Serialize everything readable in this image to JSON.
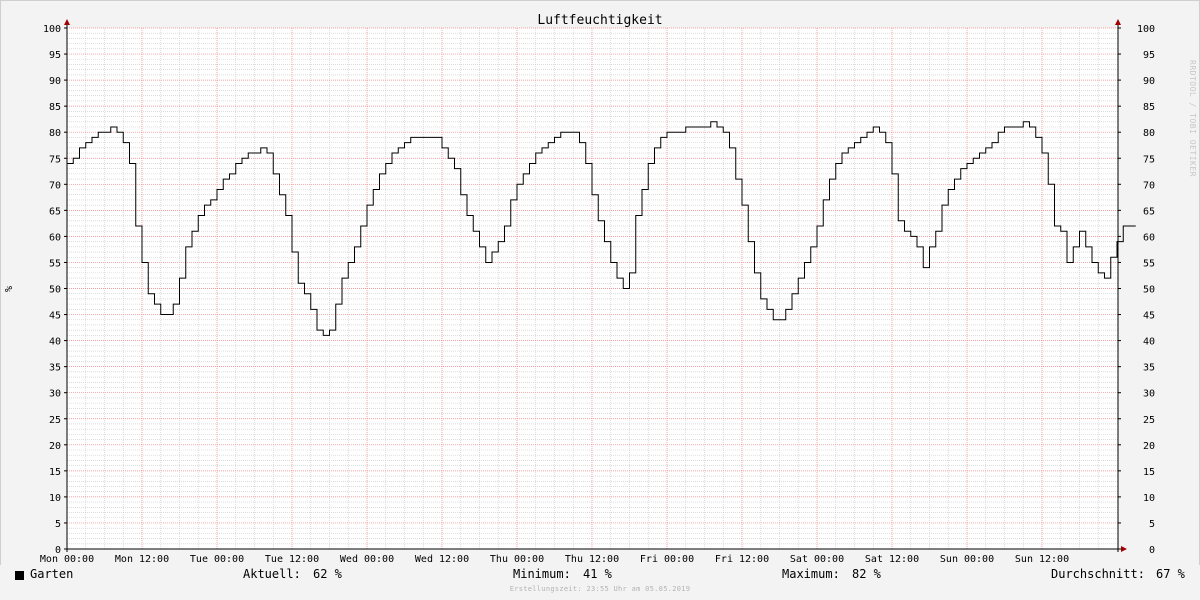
{
  "chart_data": {
    "type": "line",
    "title": "Luftfeuchtigkeit",
    "ylabel": "%",
    "ylim": [
      0,
      100
    ],
    "y_ticks": [
      0,
      5,
      10,
      15,
      20,
      25,
      30,
      35,
      40,
      45,
      50,
      55,
      60,
      65,
      70,
      75,
      80,
      85,
      90,
      95,
      100
    ],
    "x_tick_labels": [
      "Mon 00:00",
      "Mon 12:00",
      "Tue 00:00",
      "Tue 12:00",
      "Wed 00:00",
      "Wed 12:00",
      "Thu 00:00",
      "Thu 12:00",
      "Fri 00:00",
      "Fri 12:00",
      "Sat 00:00",
      "Sat 12:00",
      "Sun 00:00",
      "Sun 12:00"
    ],
    "x_unit": "hours from Mon 00:00",
    "x_range_hours": [
      0,
      168
    ],
    "line_color": "#000000",
    "grid": true,
    "major_grid_color": "#f08080",
    "minor_grid_color": "#c8c8c8",
    "series": [
      {
        "name": "Garten",
        "points": [
          [
            0,
            74
          ],
          [
            1,
            75
          ],
          [
            2,
            77
          ],
          [
            3,
            78
          ],
          [
            4,
            79
          ],
          [
            5,
            80
          ],
          [
            6,
            80
          ],
          [
            7,
            81
          ],
          [
            8,
            80
          ],
          [
            9,
            78
          ],
          [
            10,
            74
          ],
          [
            11,
            62
          ],
          [
            12,
            55
          ],
          [
            13,
            49
          ],
          [
            14,
            47
          ],
          [
            15,
            45
          ],
          [
            16,
            45
          ],
          [
            17,
            47
          ],
          [
            18,
            52
          ],
          [
            19,
            58
          ],
          [
            20,
            61
          ],
          [
            21,
            64
          ],
          [
            22,
            66
          ],
          [
            23,
            67
          ],
          [
            24,
            69
          ],
          [
            25,
            71
          ],
          [
            26,
            72
          ],
          [
            27,
            74
          ],
          [
            28,
            75
          ],
          [
            29,
            76
          ],
          [
            30,
            76
          ],
          [
            31,
            77
          ],
          [
            32,
            76
          ],
          [
            33,
            72
          ],
          [
            34,
            68
          ],
          [
            35,
            64
          ],
          [
            36,
            57
          ],
          [
            37,
            51
          ],
          [
            38,
            49
          ],
          [
            39,
            46
          ],
          [
            40,
            42
          ],
          [
            41,
            41
          ],
          [
            42,
            42
          ],
          [
            43,
            47
          ],
          [
            44,
            52
          ],
          [
            45,
            55
          ],
          [
            46,
            58
          ],
          [
            47,
            62
          ],
          [
            48,
            66
          ],
          [
            49,
            69
          ],
          [
            50,
            72
          ],
          [
            51,
            74
          ],
          [
            52,
            76
          ],
          [
            53,
            77
          ],
          [
            54,
            78
          ],
          [
            55,
            79
          ],
          [
            56,
            79
          ],
          [
            57,
            79
          ],
          [
            58,
            79
          ],
          [
            59,
            79
          ],
          [
            60,
            77
          ],
          [
            61,
            75
          ],
          [
            62,
            73
          ],
          [
            63,
            68
          ],
          [
            64,
            64
          ],
          [
            65,
            61
          ],
          [
            66,
            58
          ],
          [
            67,
            55
          ],
          [
            68,
            57
          ],
          [
            69,
            59
          ],
          [
            70,
            62
          ],
          [
            71,
            67
          ],
          [
            72,
            70
          ],
          [
            73,
            72
          ],
          [
            74,
            74
          ],
          [
            75,
            76
          ],
          [
            76,
            77
          ],
          [
            77,
            78
          ],
          [
            78,
            79
          ],
          [
            79,
            80
          ],
          [
            80,
            80
          ],
          [
            81,
            80
          ],
          [
            82,
            78
          ],
          [
            83,
            74
          ],
          [
            84,
            68
          ],
          [
            85,
            63
          ],
          [
            86,
            59
          ],
          [
            87,
            55
          ],
          [
            88,
            52
          ],
          [
            89,
            50
          ],
          [
            90,
            53
          ],
          [
            91,
            64
          ],
          [
            92,
            69
          ],
          [
            93,
            74
          ],
          [
            94,
            77
          ],
          [
            95,
            79
          ],
          [
            96,
            80
          ],
          [
            97,
            80
          ],
          [
            98,
            80
          ],
          [
            99,
            81
          ],
          [
            100,
            81
          ],
          [
            101,
            81
          ],
          [
            102,
            81
          ],
          [
            103,
            82
          ],
          [
            104,
            81
          ],
          [
            105,
            80
          ],
          [
            106,
            77
          ],
          [
            107,
            71
          ],
          [
            108,
            66
          ],
          [
            109,
            59
          ],
          [
            110,
            53
          ],
          [
            111,
            48
          ],
          [
            112,
            46
          ],
          [
            113,
            44
          ],
          [
            114,
            44
          ],
          [
            115,
            46
          ],
          [
            116,
            49
          ],
          [
            117,
            52
          ],
          [
            118,
            55
          ],
          [
            119,
            58
          ],
          [
            120,
            62
          ],
          [
            121,
            67
          ],
          [
            122,
            71
          ],
          [
            123,
            74
          ],
          [
            124,
            76
          ],
          [
            125,
            77
          ],
          [
            126,
            78
          ],
          [
            127,
            79
          ],
          [
            128,
            80
          ],
          [
            129,
            81
          ],
          [
            130,
            80
          ],
          [
            131,
            78
          ],
          [
            132,
            72
          ],
          [
            133,
            63
          ],
          [
            134,
            61
          ],
          [
            135,
            60
          ],
          [
            136,
            58
          ],
          [
            137,
            54
          ],
          [
            138,
            58
          ],
          [
            139,
            61
          ],
          [
            140,
            66
          ],
          [
            141,
            69
          ],
          [
            142,
            71
          ],
          [
            143,
            73
          ],
          [
            144,
            74
          ],
          [
            145,
            75
          ],
          [
            146,
            76
          ],
          [
            147,
            77
          ],
          [
            148,
            78
          ],
          [
            149,
            80
          ],
          [
            150,
            81
          ],
          [
            151,
            81
          ],
          [
            152,
            81
          ],
          [
            153,
            82
          ],
          [
            154,
            81
          ],
          [
            155,
            79
          ],
          [
            156,
            76
          ],
          [
            157,
            70
          ],
          [
            158,
            62
          ],
          [
            159,
            61
          ],
          [
            160,
            55
          ],
          [
            161,
            58
          ],
          [
            162,
            61
          ],
          [
            163,
            58
          ],
          [
            164,
            55
          ],
          [
            165,
            53
          ],
          [
            166,
            52
          ],
          [
            167,
            56
          ],
          [
            168,
            59
          ],
          [
            169,
            62
          ],
          [
            170,
            62
          ]
        ]
      }
    ]
  },
  "watermark": "RRDTOOL / TOBI OETIKER",
  "legend": {
    "series_name": "Garten",
    "aktuell_label": "Aktuell:",
    "aktuell_value": "62 %",
    "minimum_label": "Minimum:",
    "minimum_value": "41 %",
    "maximum_label": "Maximum:",
    "maximum_value": "82 %",
    "durchschnitt_label": "Durchschnitt:",
    "durchschnitt_value": "67 %"
  },
  "footer": "Erstellungszeit: 23:55 Uhr am 05.05.2019"
}
